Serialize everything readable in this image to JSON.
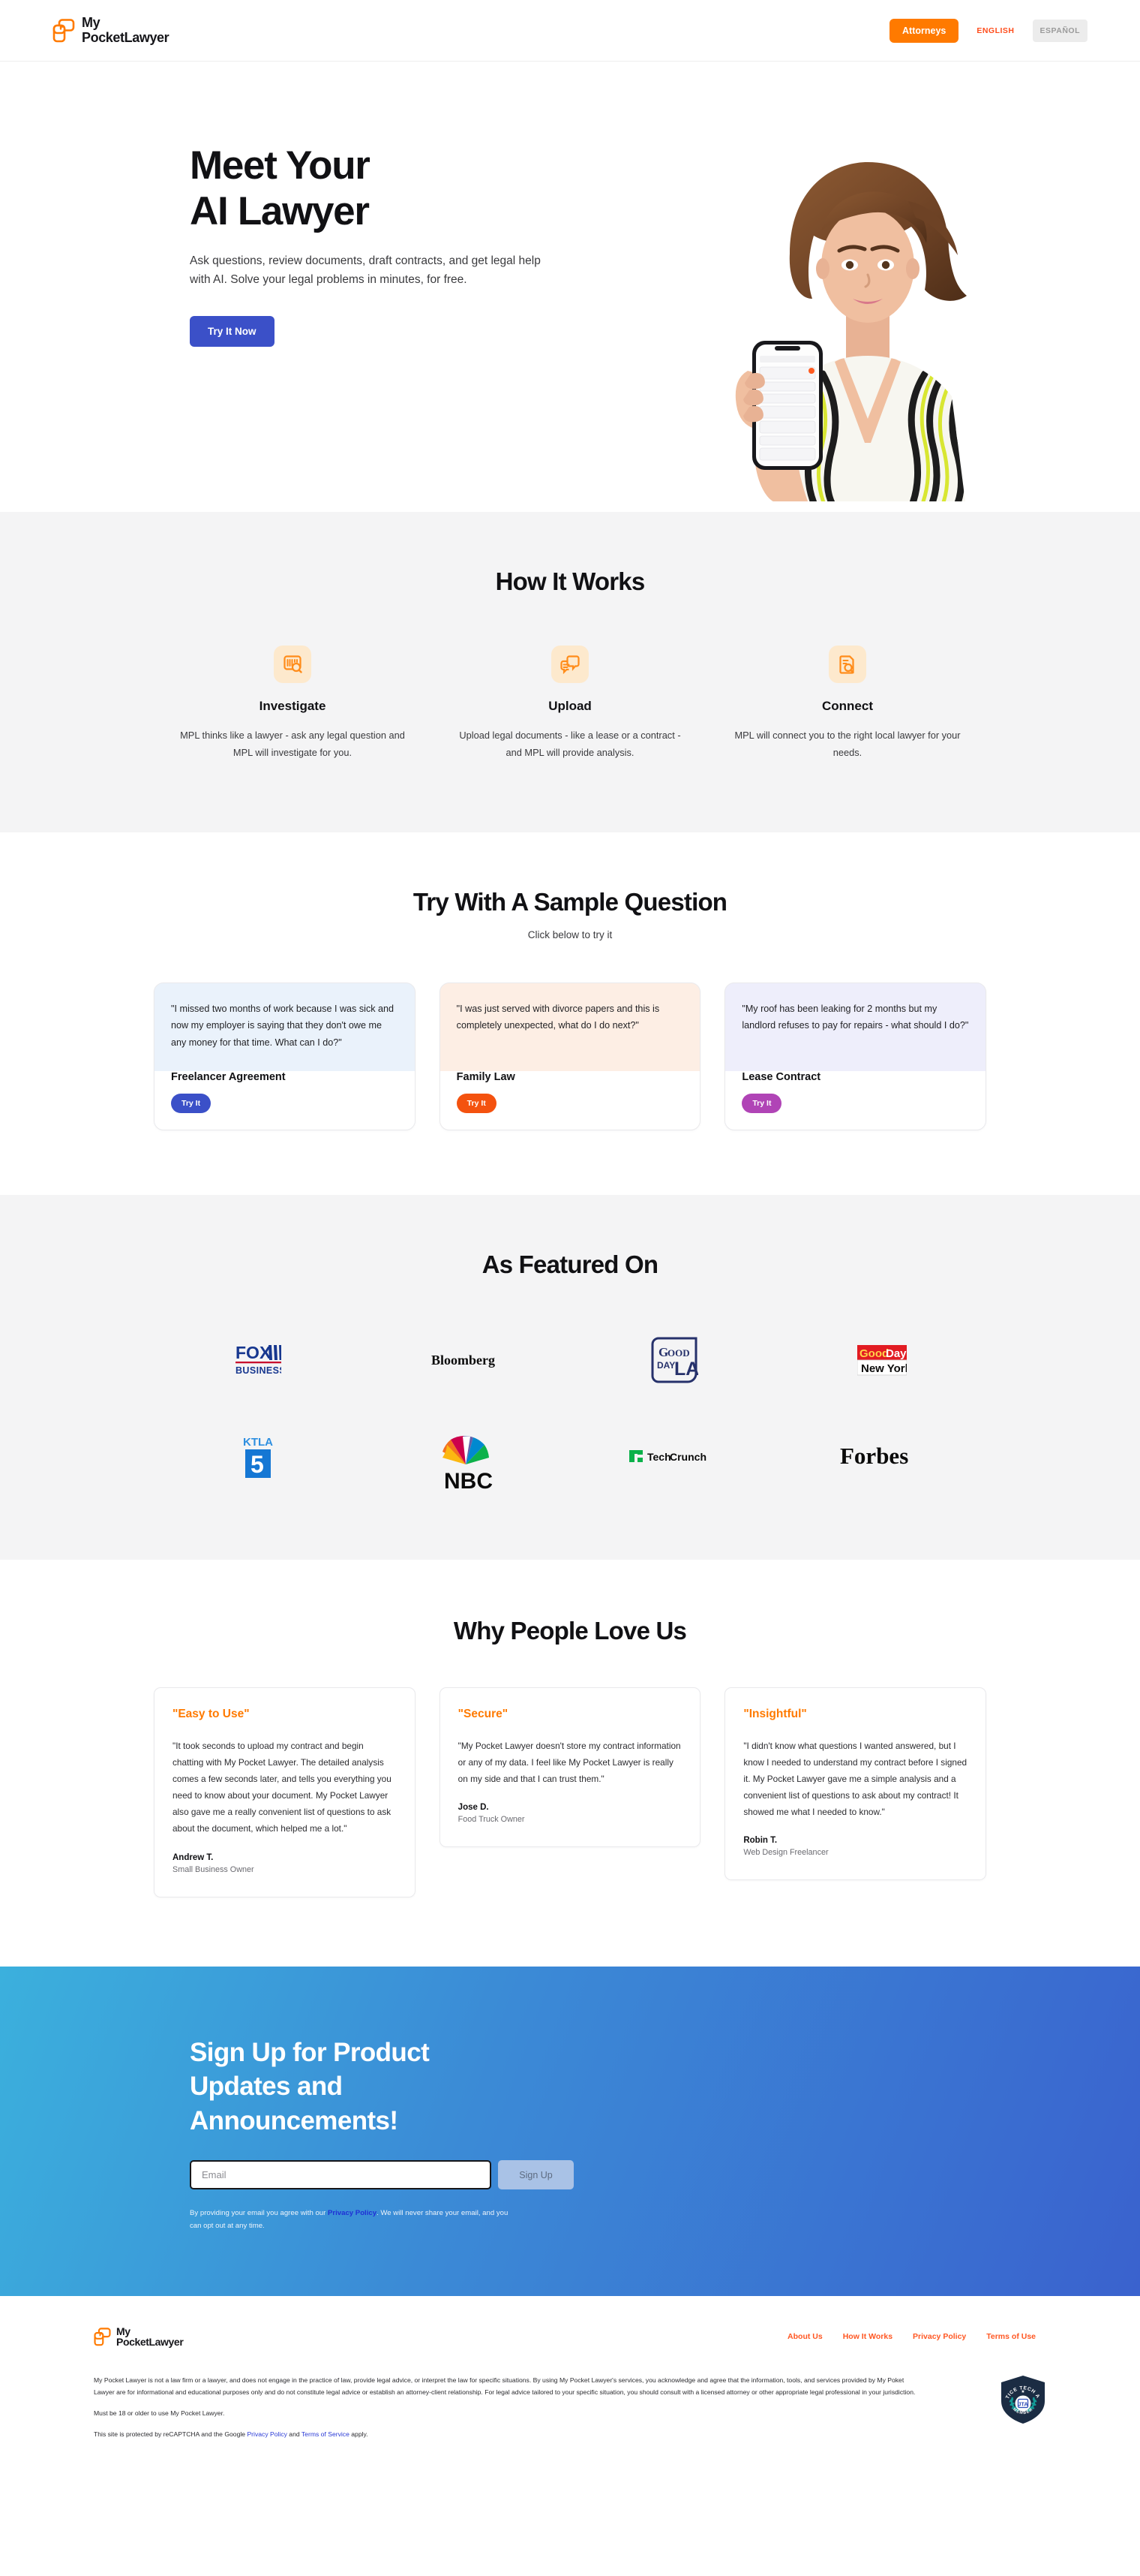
{
  "brand": {
    "line1": "My",
    "line2_a": "Pocket",
    "line2_b": "Lawyer",
    "accent": "#ff7a00"
  },
  "header": {
    "attorneys_label": "Attorneys",
    "lang_english": "ENGLISH",
    "lang_spanish": "ESPAÑOL"
  },
  "hero": {
    "title_line1": "Meet Your",
    "title_line2": "AI Lawyer",
    "subtitle": "Ask questions, review documents, draft contracts, and get legal help with AI. Solve your legal problems in minutes, for free.",
    "cta_label": "Try It Now",
    "cta_color": "#3b50c8",
    "image_alt": "woman-holding-phone-photo"
  },
  "how_it_works": {
    "title": "How It Works",
    "steps": [
      {
        "icon": "document-search-icon",
        "title": "Investigate",
        "text": "MPL thinks like a lawyer - ask any legal question and MPL will investigate for you."
      },
      {
        "icon": "chat-documents-icon",
        "title": "Upload",
        "text": "Upload legal documents - like a lease or a contract - and MPL will provide analysis."
      },
      {
        "icon": "document-magnifier-icon",
        "title": "Connect",
        "text": "MPL will connect you to the right local lawyer for your needs."
      }
    ]
  },
  "sample_questions": {
    "title": "Try With A Sample Question",
    "subtitle": "Click below to try it",
    "cards": [
      {
        "quote": "\"I missed two months of work because I was sick and now my employer is saying that they don't owe me any money for that time. What can I do?\"",
        "label": "Freelancer Agreement",
        "button": "Try It",
        "bg": "#eaf2fb",
        "button_color": "#3b50c8"
      },
      {
        "quote": "\"I was just served with divorce papers and this is completely unexpected, what do I do next?\"",
        "label": "Family Law",
        "button": "Try It",
        "bg": "#fdeee4",
        "button_color": "#f4520f"
      },
      {
        "quote": "\"My roof has been leaking for 2 months but my landlord refuses to pay for repairs - what should I do?\"",
        "label": "Lease Contract",
        "button": "Try It",
        "bg": "#eeeefb",
        "button_color": "#b044b6"
      }
    ]
  },
  "featured": {
    "title": "As Featured On",
    "row1": [
      "FOX BUSINESS",
      "Bloomberg",
      "GOOD DAY LA",
      "GoodDay New York"
    ],
    "row2": [
      "KTLA 5",
      "NBC",
      "TechCrunch",
      "Forbes"
    ]
  },
  "testimonials": {
    "title": "Why People Love Us",
    "cards": [
      {
        "heading": "\"Easy to Use\"",
        "quote": "\"It took seconds to upload my contract and begin chatting with My Pocket Lawyer. The detailed analysis comes a few seconds later, and tells you everything you need to know about your document. My Pocket Lawyer also gave me a really convenient list of questions to ask about the document, which helped me a lot.\"",
        "name": "Andrew T.",
        "role": "Small Business Owner"
      },
      {
        "heading": "\"Secure\"",
        "quote": "\"My Pocket Lawyer doesn't store my contract information or any of my data. I feel like My Pocket Lawyer is really on my side and that I can trust them.\"",
        "name": "Jose D.",
        "role": "Food Truck Owner"
      },
      {
        "heading": "\"Insightful\"",
        "quote": "\"I didn't know what questions I wanted answered, but I know I needed to understand my contract before I signed it. My Pocket Lawyer gave me a simple analysis and a convenient list of questions to ask about my contract! It showed me what I needed to know.\"",
        "name": "Robin T.",
        "role": "Web Design Freelancer"
      }
    ]
  },
  "newsletter": {
    "heading": "Sign Up for Product Updates and Announcements!",
    "email_placeholder": "Email",
    "email_value": "",
    "signup_label": "Sign Up",
    "fine_before": "By providing your email you agree with our ",
    "fine_link": "Privacy Policy",
    "fine_after": ". We will never share your email, and you can opt out at any time."
  },
  "footer": {
    "nav": [
      "About Us",
      "How It Works",
      "Privacy Policy",
      "Terms of Use"
    ],
    "disclaimer": "My Pocket Lawyer is not a law firm or a lawyer, and does not engage in the practice of law, provide legal advice, or interpret the law for specific situations. By using My Pocket Lawyer's services, you acknowledge and agree that the information, tools, and services provided by My Poket Lawyer are for informational and educational purposes only and do not constitute legal advice or establish an attorney-client relationship. For legal advice tailored to your specific situation, you should consult with a licensed attorney or other appropriate legal professional in your jurisdiction.",
    "age_notice": "Must be 18 or older to use My Pocket Lawyer.",
    "recaptcha_before": "This site is protected by reCAPTCHA and the Google ",
    "recaptcha_link1": "Privacy Policy",
    "recaptcha_mid": " and ",
    "recaptcha_link2": "Terms of Service",
    "recaptcha_after": " apply.",
    "badge": {
      "top_text": "JUSTICE TECH ASSN",
      "center_text": "JTA",
      "bottom_text": "MEMBER"
    }
  }
}
